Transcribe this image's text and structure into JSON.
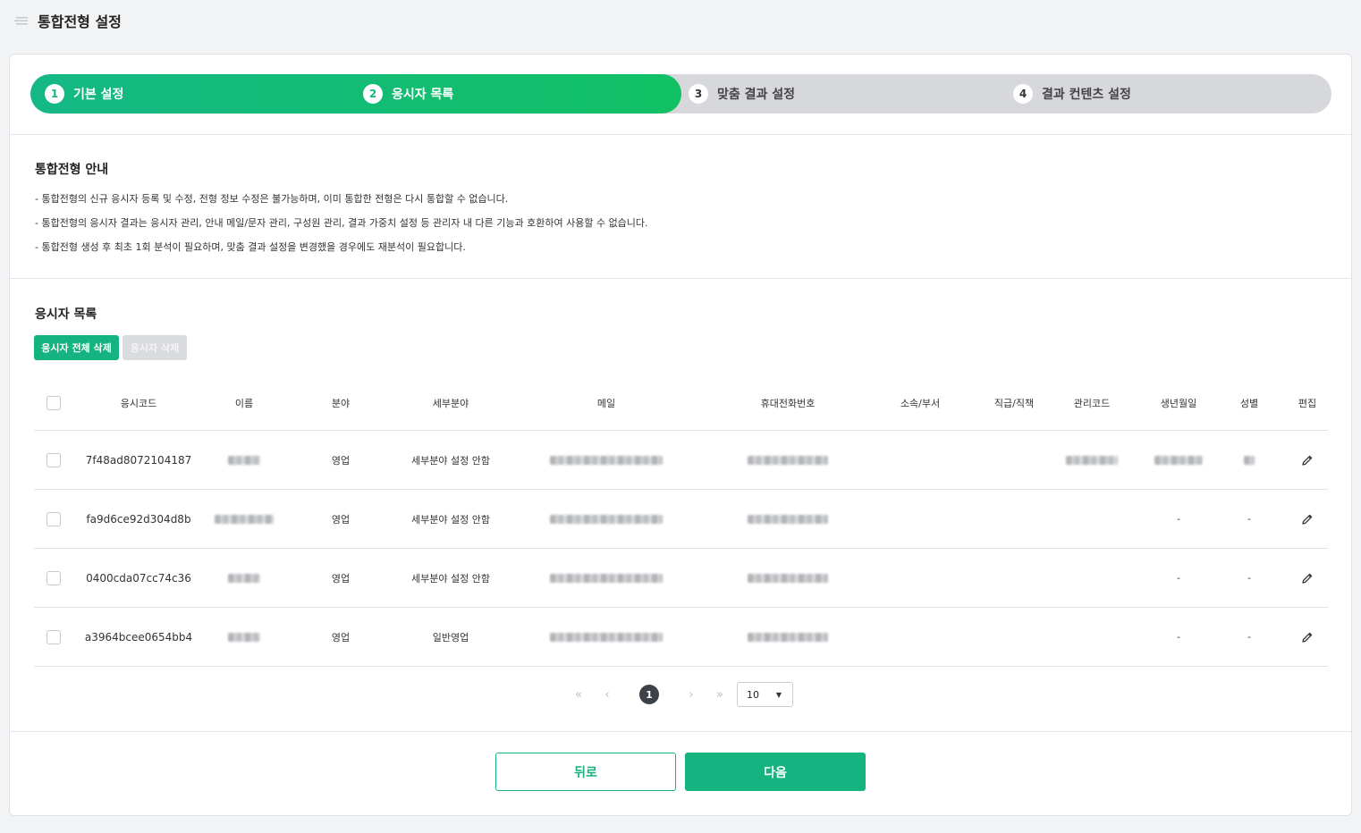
{
  "header": {
    "title": "통합전형 설정",
    "menu_icon": "menu-icon"
  },
  "stepper": {
    "progress_fraction": 0.5,
    "steps": [
      {
        "num": "1",
        "label": "기본 설정",
        "active": true
      },
      {
        "num": "2",
        "label": "응시자 목록",
        "active": true
      },
      {
        "num": "3",
        "label": "맞춤 결과 설정",
        "active": false
      },
      {
        "num": "4",
        "label": "결과 컨텐츠 설정",
        "active": false
      }
    ]
  },
  "notice": {
    "title": "통합전형 안내",
    "lines": [
      "- 통합전형의 신규 응시자 등록 및 수정, 전형 정보 수정은 불가능하며, 이미 통합한 전형은 다시 통합할 수 없습니다.",
      "- 통합전형의 응시자 결과는 응시자 관리, 안내 메일/문자 관리, 구성원 관리, 결과 가중치 설정 등 관리자 내 다른 기능과 호환하여 사용할 수 없습니다.",
      "- 통합전형 생성 후 최초 1회 분석이 필요하며, 맞춤 결과 설정을 변경했을 경우에도 재분석이 필요합니다."
    ]
  },
  "applicants": {
    "title": "응시자 목록",
    "delete_all_label": "응시자 전체 삭제",
    "delete_label": "응시자 삭제",
    "columns": [
      "응시코드",
      "이름",
      "분야",
      "세부분야",
      "메일",
      "휴대전화번호",
      "소속/부서",
      "직급/직책",
      "관리코드",
      "생년월일",
      "성별",
      "편집"
    ],
    "rows": [
      {
        "code": "7f48ad8072104187",
        "field": "영업",
        "subfield": "세부분야 설정 안함",
        "birth": "",
        "gender": ""
      },
      {
        "code": "fa9d6ce92d304d8b",
        "field": "영업",
        "subfield": "세부분야 설정 안함",
        "birth": "-",
        "gender": "-"
      },
      {
        "code": "0400cda07cc74c36",
        "field": "영업",
        "subfield": "세부분야 설정 안함",
        "birth": "-",
        "gender": "-"
      },
      {
        "code": "a3964bcee0654bb4",
        "field": "영업",
        "subfield": "일반영업",
        "birth": "-",
        "gender": "-"
      }
    ],
    "edit_icon": "pencil-icon"
  },
  "pagination": {
    "first": "«",
    "prev": "‹",
    "current": "1",
    "next": "›",
    "last": "»",
    "page_size": "10"
  },
  "footer": {
    "back_label": "뒤로",
    "next_label": "다음"
  },
  "colors": {
    "accent": "#14b380",
    "stepper_inactive": "#d6d8dc"
  }
}
